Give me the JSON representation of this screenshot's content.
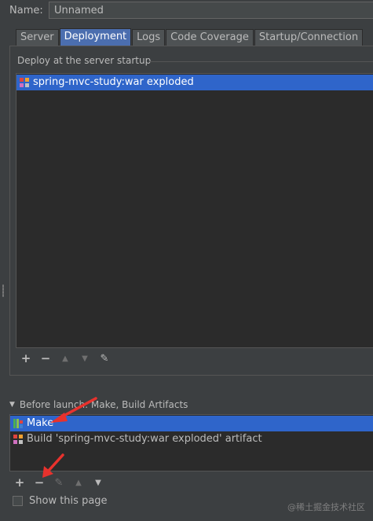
{
  "name_row": {
    "label": "Name:",
    "value": "Unnamed"
  },
  "tabs": [
    {
      "label": "Server",
      "active": false
    },
    {
      "label": "Deployment",
      "active": true
    },
    {
      "label": "Logs",
      "active": false
    },
    {
      "label": "Code Coverage",
      "active": false
    },
    {
      "label": "Startup/Connection",
      "active": false
    }
  ],
  "deploy": {
    "section_title": "Deploy at the server startup",
    "items": [
      {
        "label": "spring-mvc-study:war exploded",
        "icon": "artifact-icon",
        "selected": true
      }
    ],
    "toolbar": [
      {
        "name": "add-icon",
        "glyph": "+",
        "enabled": true
      },
      {
        "name": "remove-icon",
        "glyph": "−",
        "enabled": true
      },
      {
        "name": "move-up-icon",
        "glyph": "▲",
        "enabled": false
      },
      {
        "name": "move-down-icon",
        "glyph": "▼",
        "enabled": false
      },
      {
        "name": "edit-icon",
        "glyph": "✎",
        "enabled": true
      }
    ]
  },
  "before_launch": {
    "header": "Before launch: Make, Build Artifacts",
    "items": [
      {
        "label": "Make",
        "icon": "make-icon",
        "selected": true
      },
      {
        "label": "Build 'spring-mvc-study:war exploded' artifact",
        "icon": "artifact-icon",
        "selected": false
      }
    ],
    "toolbar": [
      {
        "name": "add-icon",
        "glyph": "+",
        "enabled": true
      },
      {
        "name": "remove-icon",
        "glyph": "−",
        "enabled": true
      },
      {
        "name": "edit-icon",
        "glyph": "✎",
        "enabled": false
      },
      {
        "name": "move-up-icon",
        "glyph": "▲",
        "enabled": false
      },
      {
        "name": "move-down-icon",
        "glyph": "▼",
        "enabled": true
      }
    ]
  },
  "show_this_page": {
    "label": "Show this page",
    "checked": false
  },
  "watermark": "@稀土掘金技术社区",
  "colors": {
    "background": "#3c3f41",
    "list_background": "#2b2b2b",
    "selection": "#2f65ca",
    "active_tab": "#4b6eaf",
    "annotation_arrow": "#e8322d"
  }
}
